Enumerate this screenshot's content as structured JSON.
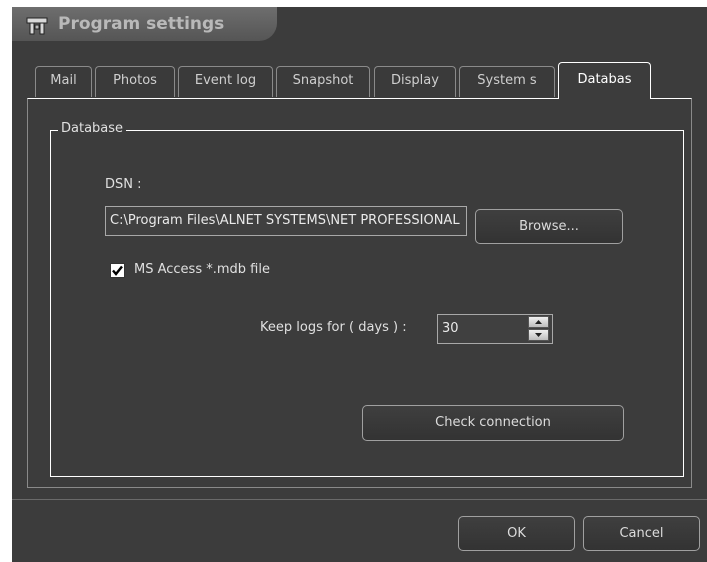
{
  "window": {
    "title": "Program settings"
  },
  "tabs": [
    {
      "label": "Mail",
      "active": false
    },
    {
      "label": "Photos",
      "active": false
    },
    {
      "label": "Event log",
      "active": false
    },
    {
      "label": "Snapshot",
      "active": false
    },
    {
      "label": "Display",
      "active": false
    },
    {
      "label": "System s",
      "active": false
    },
    {
      "label": "Databas",
      "active": true
    }
  ],
  "database": {
    "group_title": "Database",
    "dsn_label": "DSN :",
    "dsn_value": "C:\\Program Files\\ALNET SYSTEMS\\NET PROFESSIONAL",
    "browse_label": "Browse...",
    "ms_access_label": "MS Access *.mdb file",
    "ms_access_checked": true,
    "keep_logs_label": "Keep logs for ( days ) :",
    "keep_logs_value": "30",
    "check_connection_label": "Check connection"
  },
  "footer": {
    "ok_label": "OK",
    "cancel_label": "Cancel"
  },
  "colors": {
    "window_bg": "#3c3c3c",
    "text": "#e0e0e0",
    "border": "#ffffff"
  },
  "icons": {
    "title": "projector-settings-icon"
  }
}
